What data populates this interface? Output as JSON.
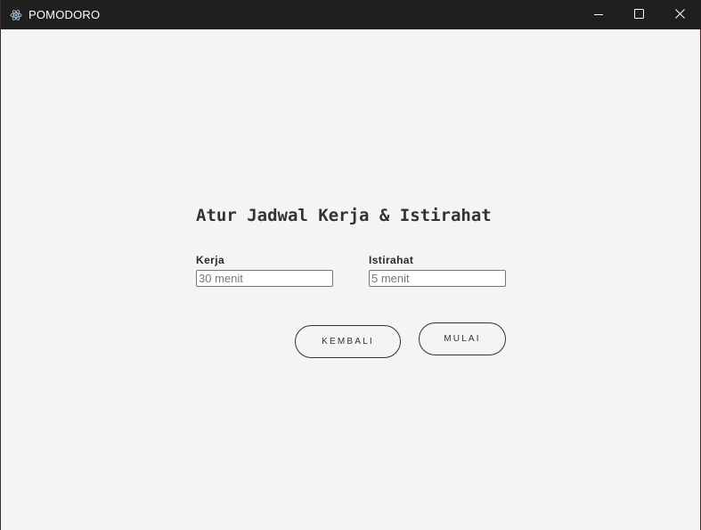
{
  "window": {
    "title": "POMODORO",
    "app_icon": "electron-atom-icon",
    "controls": {
      "minimize_icon": "minimize-icon",
      "maximize_icon": "maximize-icon",
      "close_icon": "close-icon"
    }
  },
  "form": {
    "heading": "Atur Jadwal Kerja & Istirahat",
    "work": {
      "label": "Kerja",
      "value": "",
      "placeholder": "30 menit"
    },
    "break": {
      "label": "Istirahat",
      "value": "",
      "placeholder": "5 menit"
    }
  },
  "actions": {
    "back_label": "KEMBALI",
    "start_label": "MULAI"
  },
  "colors": {
    "titlebar_bg": "#1f1f1f",
    "content_bg": "#f4f4f4",
    "text": "#333333"
  }
}
